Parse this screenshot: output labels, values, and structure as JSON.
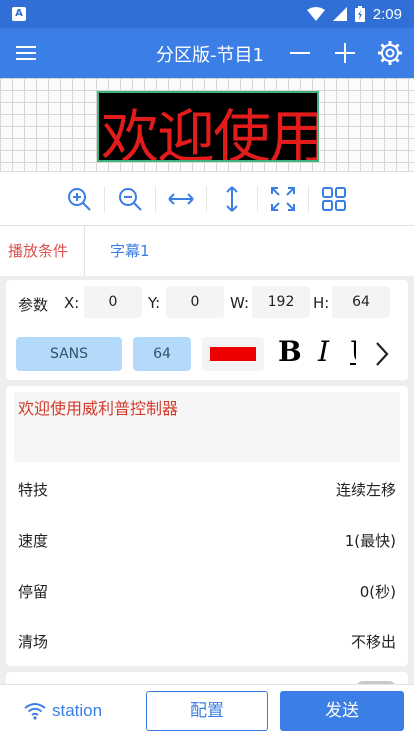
{
  "status_bar": {
    "time": "2:09",
    "app_badge": "A"
  },
  "app_bar": {
    "title": "分区版-节目1"
  },
  "preview": {
    "led_text": "欢迎使用威利普控制器"
  },
  "tabs": [
    {
      "label": "播放条件",
      "active": false
    },
    {
      "label": "字幕1",
      "active": true
    }
  ],
  "params": {
    "label": "参数",
    "x_label": "X:",
    "x_value": "0",
    "y_label": "Y:",
    "y_value": "0",
    "w_label": "W:",
    "w_value": "192",
    "h_label": "H:",
    "h_value": "64"
  },
  "style": {
    "font_name": "SANS",
    "font_size": "64",
    "text_color": "#ee0000",
    "bold_label": "B",
    "italic_label": "I",
    "underline_label": "U"
  },
  "content": {
    "text": "欢迎使用威利普控制器",
    "rows": [
      {
        "key": "特技",
        "value": "连续左移"
      },
      {
        "key": "速度",
        "value": "1(最快)"
      },
      {
        "key": "停留",
        "value": "0(秒)"
      },
      {
        "key": "清场",
        "value": "不移出"
      }
    ]
  },
  "bottom": {
    "wifi_name": "station",
    "config_label": "配置",
    "send_label": "发送"
  },
  "colors": {
    "primary": "#3a7ee6",
    "tab_active": "#3a7ee6",
    "tab_inactive": "#d9534f"
  }
}
